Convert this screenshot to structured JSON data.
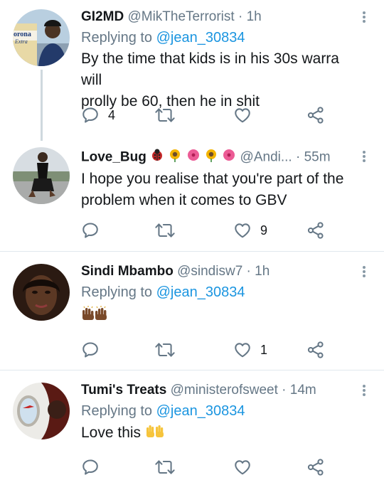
{
  "tweets": [
    {
      "display_name": "GI2MD",
      "handle": "@MikTheTerrorist",
      "separator": "·",
      "time": "1h",
      "replying_prefix": "Replying to",
      "replying_to": "@jean_30834",
      "text_line1": "By the time that kids is in his 30s warra will",
      "text_line2": "prolly be 60, then he in shit",
      "reply_count": "4",
      "retweet_count": "",
      "like_count": ""
    },
    {
      "display_name": "Love_Bug",
      "handle": "@Andi...",
      "separator": "·",
      "time": "55m",
      "text_line1": "I hope you realise that you're part of the",
      "text_line2": "problem when it comes to GBV",
      "reply_count": "",
      "retweet_count": "",
      "like_count": "9"
    },
    {
      "display_name": "Sindi Mbambo",
      "handle": "@sindisw7",
      "separator": "·",
      "time": "1h",
      "replying_prefix": "Replying to",
      "replying_to": "@jean_30834",
      "reply_count": "",
      "retweet_count": "",
      "like_count": "1"
    },
    {
      "display_name": "Tumi's Treats",
      "handle": "@ministerofsweet",
      "separator": "·",
      "time": "14m",
      "replying_prefix": "Replying to",
      "replying_to": "@jean_30834",
      "text_line1": "Love this",
      "reply_count": "",
      "retweet_count": "",
      "like_count": ""
    }
  ],
  "icons": {
    "reply": "reply-icon",
    "retweet": "retweet-icon",
    "like": "like-icon",
    "share": "share-icon",
    "more": "more-options-icon"
  },
  "colors": {
    "link": "#1b95e0",
    "secondary_text": "#657786",
    "icon": "#657786",
    "divider": "#e1e8ed"
  }
}
